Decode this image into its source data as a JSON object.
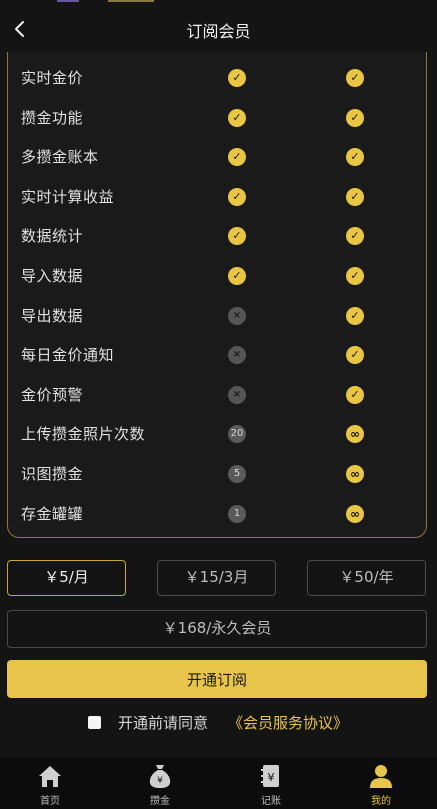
{
  "header": {
    "title": "订阅会员"
  },
  "features": [
    {
      "label": "实时金价",
      "basic": "✓",
      "premium": "✓"
    },
    {
      "label": "攒金功能",
      "basic": "✓",
      "premium": "✓"
    },
    {
      "label": "多攒金账本",
      "basic": "✓",
      "premium": "✓"
    },
    {
      "label": "实时计算收益",
      "basic": "✓",
      "premium": "✓"
    },
    {
      "label": "数据统计",
      "basic": "✓",
      "premium": "✓"
    },
    {
      "label": "导入数据",
      "basic": "✓",
      "premium": "✓"
    },
    {
      "label": "导出数据",
      "basic": "×",
      "premium": "✓"
    },
    {
      "label": "每日金价通知",
      "basic": "×",
      "premium": "✓"
    },
    {
      "label": "金价预警",
      "basic": "×",
      "premium": "✓"
    },
    {
      "label": "上传攒金照片次数",
      "basic": "20",
      "premium": "∞"
    },
    {
      "label": "识图攒金",
      "basic": "5",
      "premium": "∞"
    },
    {
      "label": "存金罐罐",
      "basic": "1",
      "premium": "∞"
    }
  ],
  "plans": {
    "monthly": "￥5/月",
    "quarterly": "￥15/3月",
    "yearly": "￥50/年",
    "lifetime": "￥168/永久会员"
  },
  "subscribe_label": "开通订阅",
  "agreement": {
    "text": "开通前请同意",
    "link": "《会员服务协议》"
  },
  "tabs": [
    {
      "label": "首页"
    },
    {
      "label": "攒金"
    },
    {
      "label": "记账"
    },
    {
      "label": "我的"
    }
  ],
  "colors": {
    "accent": "#e8c44a",
    "background": "#141414"
  }
}
